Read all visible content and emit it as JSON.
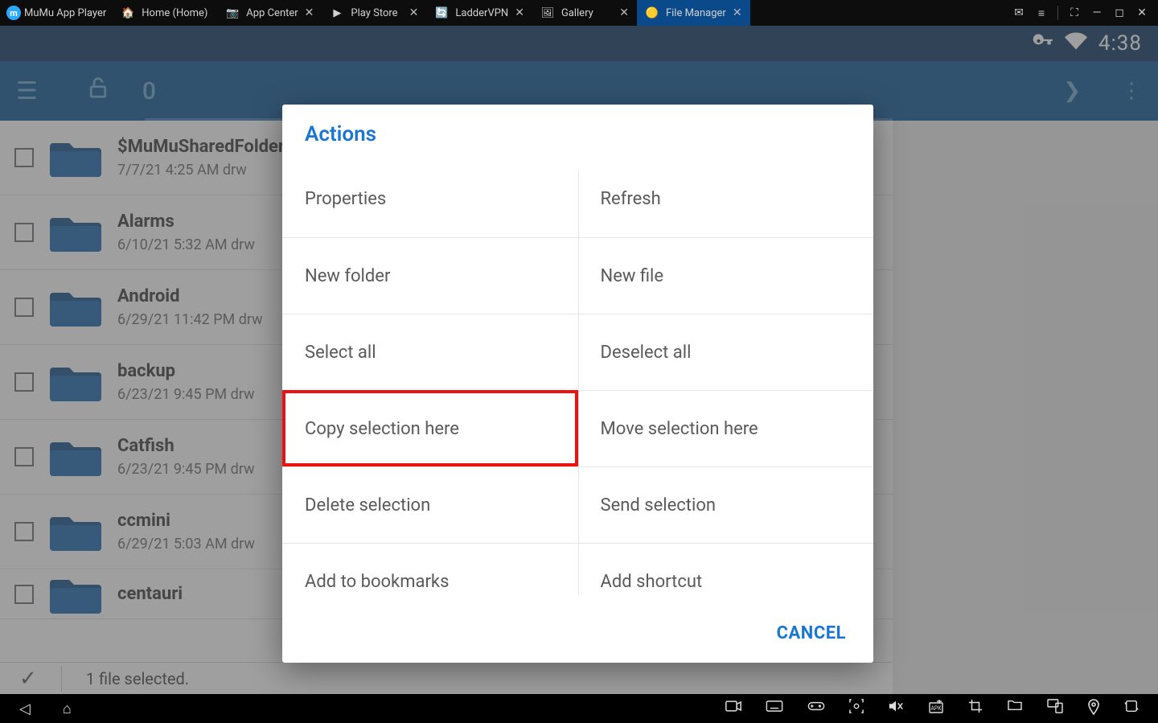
{
  "titlebar": {
    "logo_text": "MuMu App Player",
    "tabs": [
      {
        "icon": "🏠",
        "label": "Home (Home)",
        "close": false
      },
      {
        "icon": "📷",
        "label": "App Center",
        "close": true
      },
      {
        "icon": "▶",
        "label": "Play Store",
        "close": true
      },
      {
        "icon": "🔄",
        "label": "LadderVPN",
        "close": true
      },
      {
        "icon": "🖼",
        "label": "Gallery",
        "close": true
      },
      {
        "icon": "🟡",
        "label": "File Manager",
        "close": true,
        "active": true
      }
    ],
    "win_buttons": [
      "✉",
      "≡",
      "⛶",
      "—",
      "◻",
      "✕"
    ]
  },
  "statusbar": {
    "clock": "4:38"
  },
  "toolbar": {
    "count": "0"
  },
  "files": [
    {
      "name": "$MuMuSharedFolder",
      "sub": "7/7/21 4:25 AM   drw"
    },
    {
      "name": "Alarms",
      "sub": "6/10/21 5:32 AM   drw"
    },
    {
      "name": "Android",
      "sub": "6/29/21 11:42 PM   drw"
    },
    {
      "name": "backup",
      "sub": "6/23/21 9:45 PM   drw"
    },
    {
      "name": "Catfish",
      "sub": "6/23/21 9:45 PM   drw"
    },
    {
      "name": "ccmini",
      "sub": "6/29/21 5:03 AM   drw"
    },
    {
      "name": "centauri",
      "sub": ""
    }
  ],
  "selection_bar": {
    "text": "1 file selected."
  },
  "dialog": {
    "title": "Actions",
    "items": [
      "Properties",
      "Refresh",
      "New folder",
      "New file",
      "Select all",
      "Deselect all",
      "Copy selection here",
      "Move selection here",
      "Delete selection",
      "Send selection",
      "Add to bookmarks",
      "Add shortcut"
    ],
    "highlight_index": 6,
    "cancel": "CANCEL"
  }
}
